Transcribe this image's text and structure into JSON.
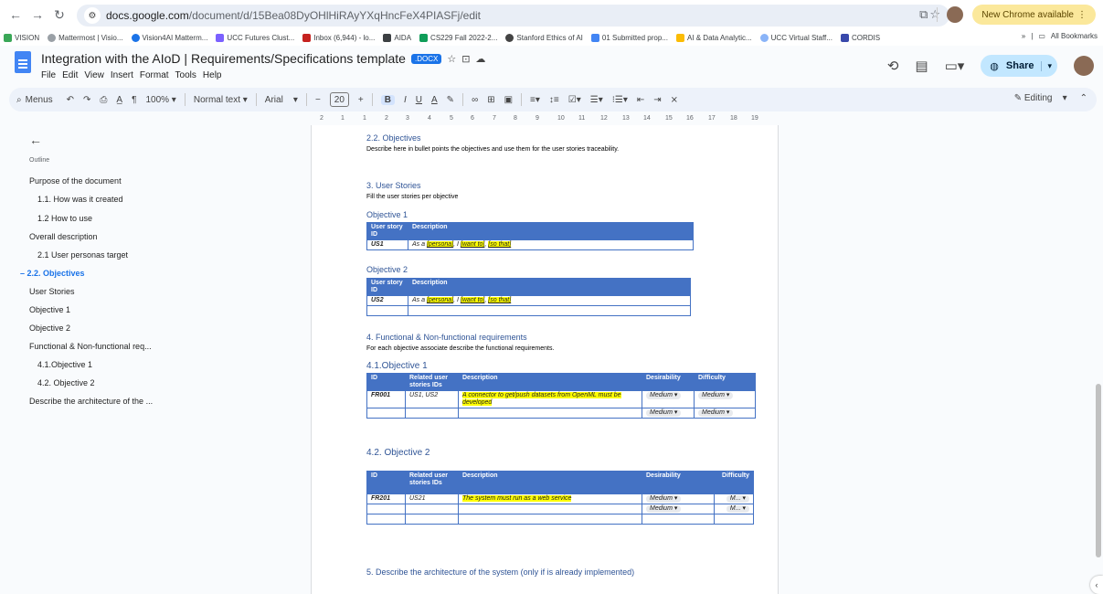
{
  "browser": {
    "url_domain": "docs.google.com",
    "url_path": "/document/d/15Bea08DyOHlHiRAyYXqHncFeX4PIASFj/edit",
    "update_label": "New Chrome available",
    "bookmarks": [
      "VISION",
      "Mattermost | Visio...",
      "Vision4AI Matterm...",
      "UCC Futures Clust...",
      "Inbox (6,944) - lo...",
      "AIDA",
      "CS229 Fall 2022-2...",
      "Stanford Ethics of AI",
      "01 Submitted prop...",
      "AI & Data Analytic...",
      "UCC Virtual Staff...",
      "CORDIS"
    ],
    "bookmarks_more": "»",
    "all_bookmarks": "All Bookmarks"
  },
  "docs": {
    "title": "Integration with the AIoD | Requirements/Specifications template",
    "badge": ".DOCX",
    "menu": [
      "File",
      "Edit",
      "View",
      "Insert",
      "Format",
      "Tools",
      "Help"
    ],
    "share_label": "Share"
  },
  "toolbar": {
    "menus": "Menus",
    "zoom": "100%",
    "style": "Normal text",
    "font": "Arial",
    "font_size": "20",
    "editing": "Editing"
  },
  "ruler": [
    "2",
    "1",
    "1",
    "2",
    "3",
    "4",
    "5",
    "6",
    "7",
    "8",
    "9",
    "10",
    "11",
    "12",
    "13",
    "14",
    "15",
    "16",
    "17",
    "18",
    "19"
  ],
  "outline": {
    "label": "Outline",
    "items": [
      {
        "text": "Purpose of the document",
        "level": 0
      },
      {
        "text": "1.1. How was it created",
        "level": 1
      },
      {
        "text": "1.2 How to use",
        "level": 1
      },
      {
        "text": "Overall description",
        "level": 0
      },
      {
        "text": "2.1 User personas target",
        "level": 1
      },
      {
        "text": "2.2. Objectives",
        "level": 0,
        "active": true
      },
      {
        "text": "User Stories",
        "level": 0
      },
      {
        "text": "Objective 1",
        "level": 0
      },
      {
        "text": "Objective 2",
        "level": 0
      },
      {
        "text": "Functional & Non-functional req...",
        "level": 0
      },
      {
        "text": "4.1.Objective 1",
        "level": 1
      },
      {
        "text": "4.2. Objective 2",
        "level": 1
      },
      {
        "text": "Describe the architecture of the ...",
        "level": 0
      }
    ]
  },
  "document": {
    "obj_heading": "2.2. Objectives",
    "obj_text": "Describe here in bullet points the objectives and use them for the user stories traceability.",
    "us_heading": "3.  User Stories",
    "us_text": "Fill the user stories per objective",
    "obj1_heading": "Objective 1",
    "obj2_heading": "Objective 2",
    "us_col_id": "User story ID",
    "us_col_desc": "Description",
    "us1_id": "US1",
    "us2_id": "US2",
    "as_a": "As a ",
    "persona": "[persona]",
    "i_text": ",  I ",
    "want_to": "[want to]",
    "comma": ",  ",
    "so_that": "[so that]",
    "fr_heading": "4.  Functional & Non-functional requirements",
    "fr_text": "For each objective associate describe the functional requirements.",
    "fr41_heading": "4.1.Objective 1",
    "fr42_heading": "4.2. Objective 2",
    "col_id": "ID",
    "col_related": "Related user stories IDs",
    "col_desc": "Description",
    "col_desirability": "Desirability",
    "col_difficulty": "Difficulty",
    "fr001_id": "FR001",
    "fr001_us": "US1, US2",
    "fr001_desc": "A connector to get/push datasets from OpenML must be developed",
    "fr201_id": "FR201",
    "fr201_us": "US21",
    "fr201_desc": "The system must run as a web service",
    "medium": "Medium",
    "m_trunc": "M...",
    "arch_heading": "5.  Describe the architecture of the system (only if is already implemented)"
  }
}
